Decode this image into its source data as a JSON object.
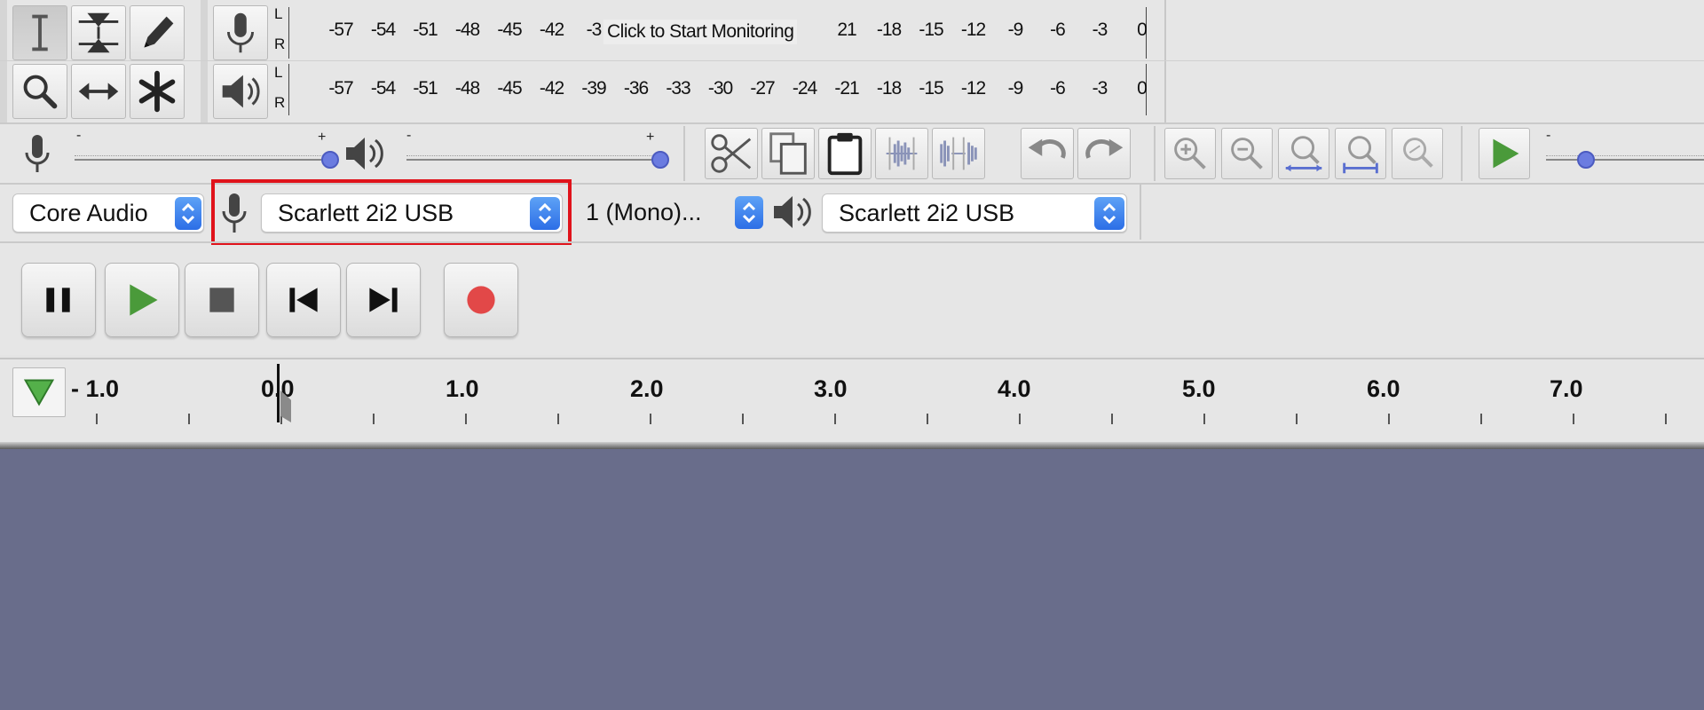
{
  "toolbar": {
    "tools": [
      {
        "name": "selection-tool",
        "icon": "i-beam-icon",
        "active": true
      },
      {
        "name": "envelope-tool",
        "icon": "envelope-icon"
      },
      {
        "name": "draw-tool",
        "icon": "pencil-icon"
      },
      {
        "name": "zoom-tool",
        "icon": "magnifier-icon"
      },
      {
        "name": "timeshift-tool",
        "icon": "double-arrow-icon"
      },
      {
        "name": "multi-tool",
        "icon": "asterisk-icon"
      }
    ]
  },
  "meters": {
    "record": {
      "channel_top": "L",
      "channel_bottom": "R",
      "ticks_left": [
        "-57",
        "-54",
        "-51",
        "-48",
        "-45",
        "-42",
        "-3"
      ],
      "ticks_right": [
        "21",
        "-18",
        "-15",
        "-12",
        "-9",
        "-6",
        "-3",
        "0"
      ],
      "monitor_label": "Click to Start Monitoring"
    },
    "playback": {
      "channel_top": "L",
      "channel_bottom": "R",
      "ticks": [
        "-57",
        "-54",
        "-51",
        "-48",
        "-45",
        "-42",
        "-39",
        "-36",
        "-33",
        "-30",
        "-27",
        "-24",
        "-21",
        "-18",
        "-15",
        "-12",
        "-9",
        "-6",
        "-3",
        "0"
      ]
    }
  },
  "mixer": {
    "minus": "-",
    "plus": "+",
    "record_volume": 1.0,
    "playback_volume": 1.0,
    "play_at_speed": 0.25
  },
  "device": {
    "host": "Core Audio",
    "recording_device": "Scarlett 2i2 USB",
    "channels": "1 (Mono)...",
    "playback_device": "Scarlett 2i2 USB"
  },
  "transport": {
    "buttons": [
      "pause",
      "play",
      "stop",
      "skip-to-start",
      "skip-to-end",
      "record"
    ]
  },
  "ruler": {
    "labels": [
      "- 1.0",
      "0.0",
      "1.0",
      "2.0",
      "3.0",
      "4.0",
      "5.0",
      "6.0",
      "7.0"
    ]
  },
  "colors": {
    "track_background": "#696d8b",
    "highlight": "#e0131b",
    "slider_knob": "#6b7ce0",
    "play_green": "#4a9a3a",
    "record_red": "#e24848",
    "select_arrow": "#2c6ee6"
  }
}
